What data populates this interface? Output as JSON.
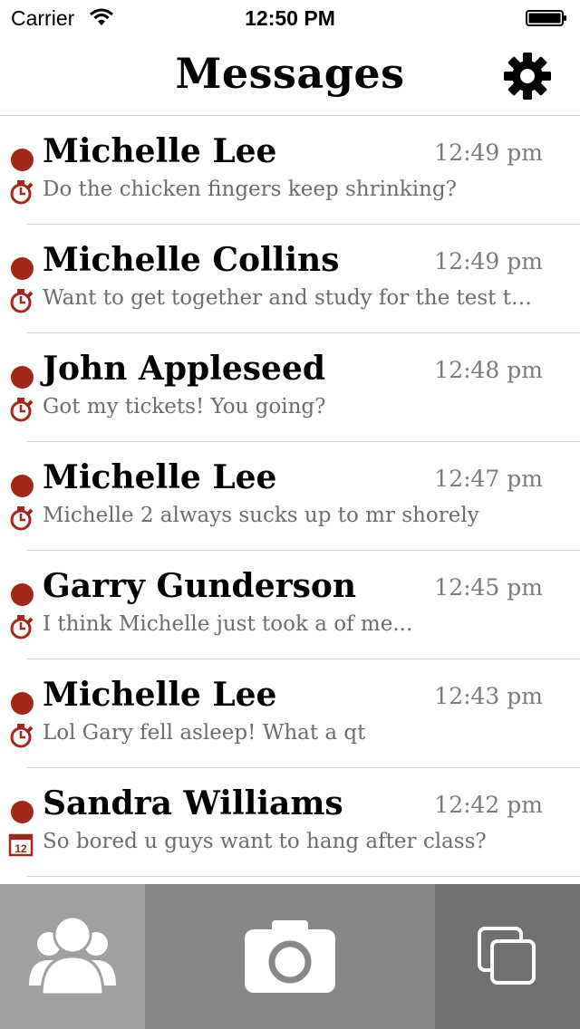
{
  "status_bar": {
    "carrier": "Carrier",
    "time": "12:50 PM",
    "icons": [
      "wifi-icon",
      "battery-icon"
    ]
  },
  "nav": {
    "title": "Messages",
    "settings_icon": "gear-icon"
  },
  "colors": {
    "unread_dot": "#a3271b",
    "icon_accent": "#a3271b",
    "time_text": "#7a7a7a",
    "preview_text": "#6c6c6c",
    "tab_friends_bg": "#a0a0a0",
    "tab_camera_bg": "#888888",
    "tab_stack_bg": "#707070"
  },
  "messages": [
    {
      "sender": "Michelle Lee",
      "time": "12:49 pm",
      "preview": "Do the chicken fingers keep shrinking?",
      "icon": "stopwatch-icon"
    },
    {
      "sender": "Michelle Collins",
      "time": "12:49 pm",
      "preview": "Want to get together and study for the test to...",
      "icon": "stopwatch-icon"
    },
    {
      "sender": "John Appleseed",
      "time": "12:48 pm",
      "preview": "Got my tickets! You going?",
      "icon": "stopwatch-icon"
    },
    {
      "sender": "Michelle Lee",
      "time": "12:47 pm",
      "preview": "Michelle 2 always sucks up to mr shorely",
      "icon": "stopwatch-icon"
    },
    {
      "sender": "Garry Gunderson",
      "time": "12:45 pm",
      "preview": "I think Michelle just took a of me...",
      "icon": "stopwatch-icon"
    },
    {
      "sender": "Michelle Lee",
      "time": "12:43 pm",
      "preview": "Lol Gary fell asleep! What a qt",
      "icon": "stopwatch-icon"
    },
    {
      "sender": "Sandra Williams",
      "time": "12:42 pm",
      "preview": "So bored u guys want to hang after class?",
      "icon": "calendar-icon",
      "icon_text": "12"
    }
  ],
  "tabs": [
    {
      "name": "friends",
      "icon": "people-icon"
    },
    {
      "name": "camera",
      "icon": "camera-icon"
    },
    {
      "name": "stack",
      "icon": "stack-icon"
    }
  ]
}
